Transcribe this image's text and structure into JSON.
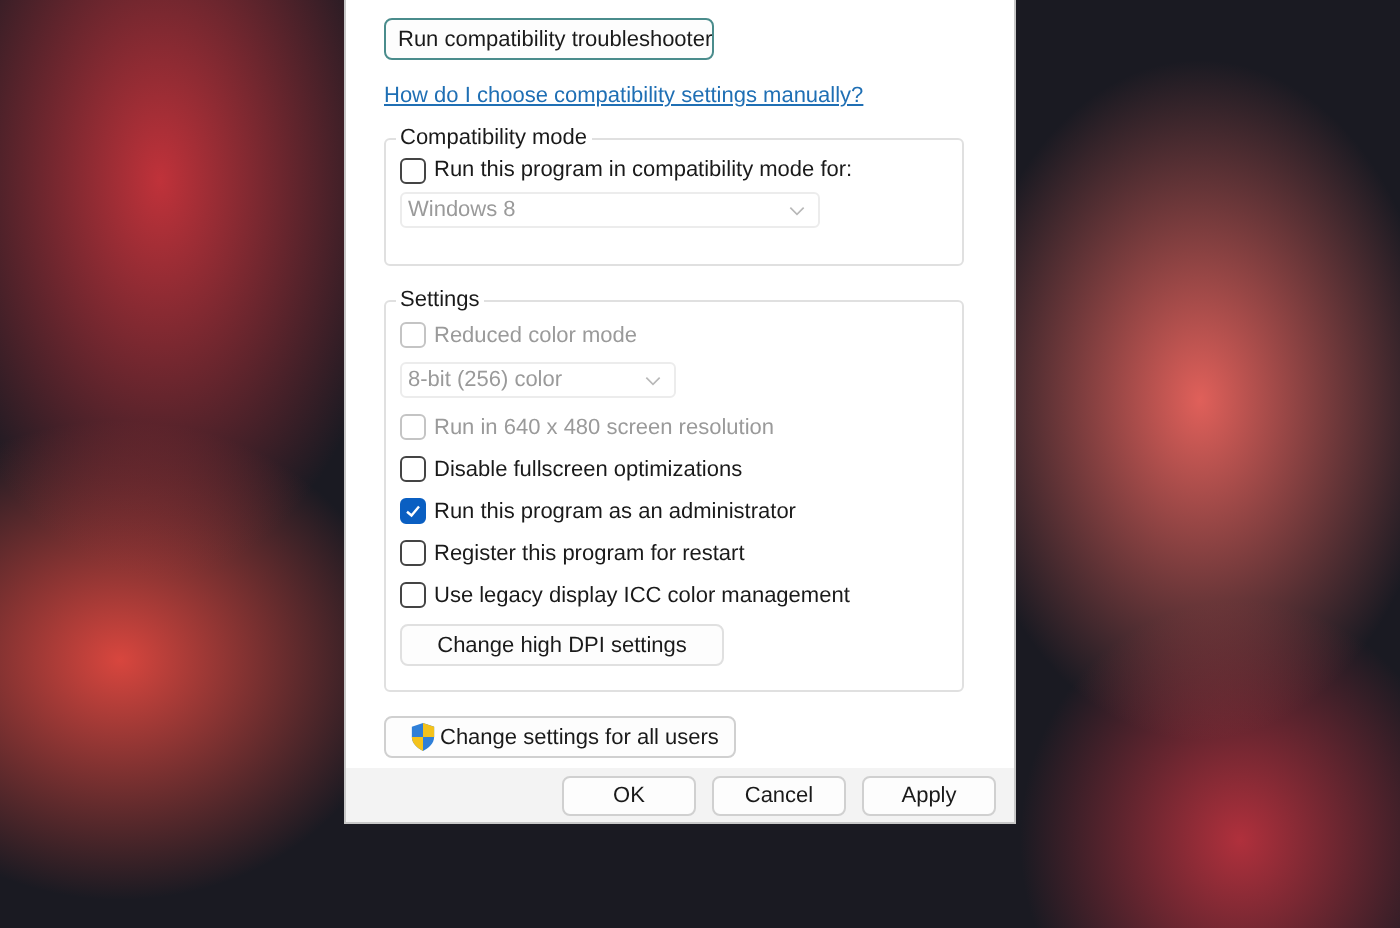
{
  "troubleshooter_button": {
    "label": "Run compatibility troubleshooter"
  },
  "help_link": "How do I choose compatibility settings manually?",
  "compatibility_mode": {
    "title": "Compatibility mode",
    "items": [
      {
        "kind": "checkbox",
        "label": "Run this program in compatibility mode for:",
        "checked": false,
        "disabled": false
      },
      {
        "kind": "dropdown",
        "value": "Windows 8",
        "disabled": true
      }
    ]
  },
  "settings": {
    "title": "Settings",
    "items": [
      {
        "kind": "checkbox",
        "label": "Reduced color mode",
        "checked": false,
        "disabled": true
      },
      {
        "kind": "dropdown",
        "value": "8-bit (256) color",
        "disabled": true
      },
      {
        "kind": "checkbox",
        "label": "Run in 640 x 480 screen resolution",
        "checked": false,
        "disabled": true
      },
      {
        "kind": "checkbox",
        "label": "Disable fullscreen optimizations",
        "checked": false,
        "disabled": false
      },
      {
        "kind": "checkbox",
        "label": "Run this program as an administrator",
        "checked": true,
        "disabled": false
      },
      {
        "kind": "checkbox",
        "label": "Register this program for restart",
        "checked": false,
        "disabled": false
      },
      {
        "kind": "checkbox",
        "label": "Use legacy display ICC color management",
        "checked": false,
        "disabled": false
      },
      {
        "kind": "button",
        "label": "Change high DPI settings"
      }
    ]
  },
  "all_users_button": {
    "label": "Change settings for all users"
  },
  "buttons": [
    {
      "label": "OK"
    },
    {
      "label": "Cancel"
    },
    {
      "label": "Apply"
    }
  ]
}
